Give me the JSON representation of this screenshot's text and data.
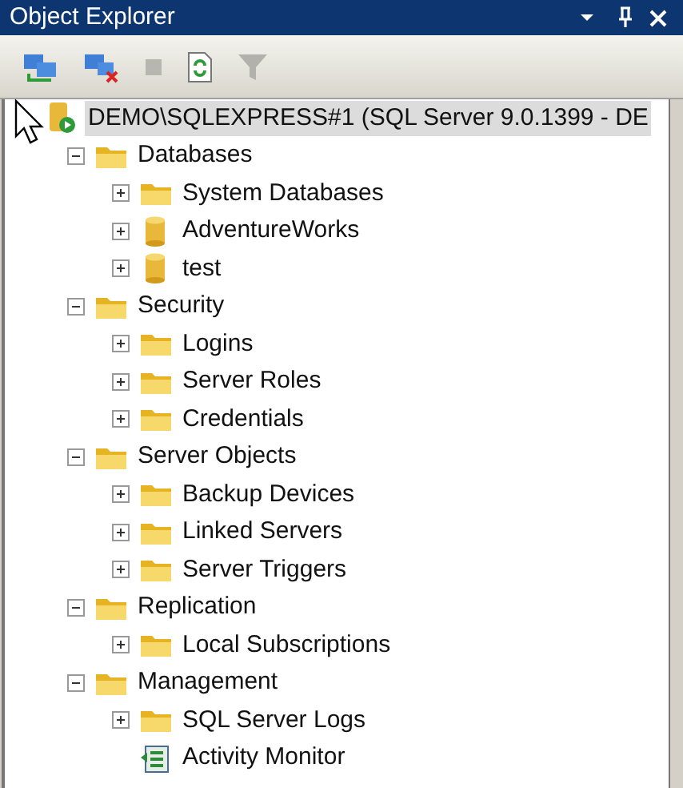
{
  "panel": {
    "title": "Object Explorer"
  },
  "tree": [
    {
      "label": "DEMO\\SQLEXPRESS#1 (SQL Server 9.0.1399 - DE",
      "kind": "server",
      "selected": true,
      "children": [
        {
          "label": "Databases",
          "kind": "folder",
          "expanded": true,
          "selected": false,
          "children": [
            {
              "label": "System Databases",
              "kind": "folder",
              "expanded": false,
              "selected": false
            },
            {
              "label": "AdventureWorks",
              "kind": "database",
              "expanded": false,
              "selected": false
            },
            {
              "label": "test",
              "kind": "database",
              "expanded": false,
              "selected": false
            }
          ]
        },
        {
          "label": "Security",
          "kind": "folder",
          "expanded": true,
          "selected": false,
          "children": [
            {
              "label": "Logins",
              "kind": "folder",
              "expanded": false,
              "selected": false
            },
            {
              "label": "Server Roles",
              "kind": "folder",
              "expanded": false,
              "selected": false
            },
            {
              "label": "Credentials",
              "kind": "folder",
              "expanded": false,
              "selected": false
            }
          ]
        },
        {
          "label": "Server Objects",
          "kind": "folder",
          "expanded": true,
          "selected": false,
          "children": [
            {
              "label": "Backup Devices",
              "kind": "folder",
              "expanded": false,
              "selected": false
            },
            {
              "label": "Linked Servers",
              "kind": "folder",
              "expanded": false,
              "selected": false
            },
            {
              "label": "Server Triggers",
              "kind": "folder",
              "expanded": false,
              "selected": false
            }
          ]
        },
        {
          "label": "Replication",
          "kind": "folder",
          "expanded": true,
          "selected": false,
          "children": [
            {
              "label": "Local Subscriptions",
              "kind": "folder",
              "expanded": false,
              "selected": false
            }
          ]
        },
        {
          "label": "Management",
          "kind": "folder",
          "expanded": true,
          "selected": false,
          "children": [
            {
              "label": "SQL Server Logs",
              "kind": "folder",
              "expanded": false,
              "selected": false
            },
            {
              "label": "Activity Monitor",
              "kind": "monitor",
              "selected": false
            }
          ]
        }
      ]
    }
  ]
}
